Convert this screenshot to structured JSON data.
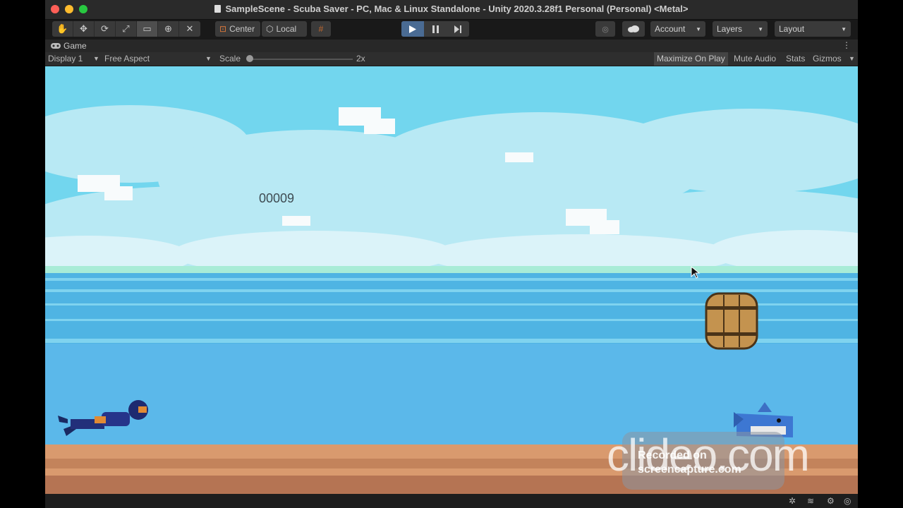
{
  "window": {
    "title": "SampleScene - Scuba Saver - PC, Mac & Linux Standalone - Unity 2020.3.28f1 Personal (Personal) <Metal>"
  },
  "toolbar": {
    "tools": [
      "hand-icon",
      "move-icon",
      "rotate-icon",
      "scale-icon",
      "rect-icon",
      "transform-icon",
      "custom-tool-icon"
    ],
    "pivot_label": "Center",
    "handle_label": "Local",
    "account_label": "Account",
    "layers_label": "Layers",
    "layout_label": "Layout"
  },
  "game_tab": {
    "label": "Game"
  },
  "game_bar": {
    "display": "Display 1",
    "aspect": "Free Aspect",
    "scale_label": "Scale",
    "scale_value": "2x",
    "maximize": "Maximize On Play",
    "mute": "Mute Audio",
    "stats": "Stats",
    "gizmos": "Gizmos"
  },
  "game": {
    "score": "00009"
  },
  "watermark": {
    "brand": "clideo.com",
    "line1": "Recorded on",
    "line2": "screencapture.com"
  },
  "colors": {
    "sky": "#72d6ee",
    "sea": "#5bb8ea",
    "sand": "#d99a6e",
    "play_active": "#4a6b93"
  }
}
